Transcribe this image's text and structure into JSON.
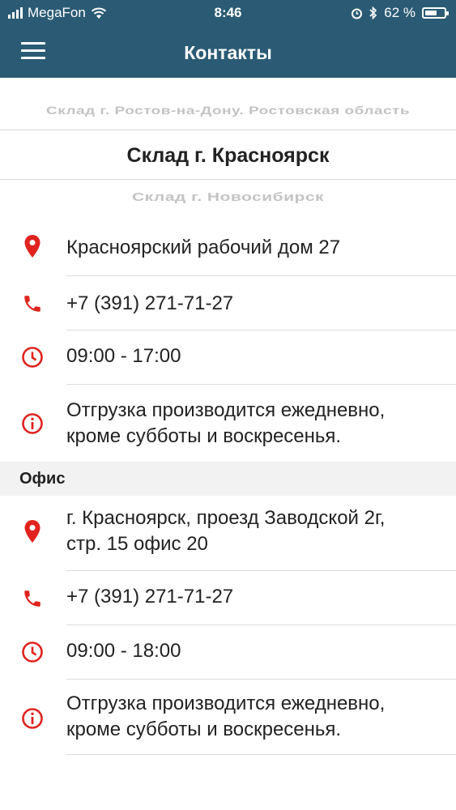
{
  "status_bar": {
    "carrier": "MegaFon",
    "time": "8:46",
    "battery": "62 %",
    "battery_level": 0.62
  },
  "header": {
    "title": "Контакты"
  },
  "picker": {
    "previous": "Склад г. Ростов-на-Дону.  Ростовская область",
    "current": "Склад г. Красноярск",
    "next": "Склад г. Новосибирск"
  },
  "warehouse": {
    "address": "Красноярский рабочий дом 27",
    "phone": "+7 (391) 271-71-27",
    "hours": "09:00 - 17:00",
    "info_line1": "Отгрузка производится ежедневно,",
    "info_line2": "кроме субботы и воскресенья."
  },
  "office": {
    "section_title": "Офис",
    "address_line1": "г. Красноярск, проезд Заводской 2г,",
    "address_line2": "стр. 15 офис 20",
    "phone": "+7 (391) 271-71-27",
    "hours": "09:00 - 18:00",
    "info_line1": "Отгрузка производится ежедневно,",
    "info_line2": "кроме субботы и воскресенья."
  },
  "colors": {
    "header_bg": "#2b5b74",
    "icon_red": "#e0231e"
  },
  "icons": {
    "location": "location-pin-icon",
    "phone": "phone-icon",
    "clock": "clock-icon",
    "info": "info-icon",
    "menu": "hamburger-menu-icon"
  }
}
